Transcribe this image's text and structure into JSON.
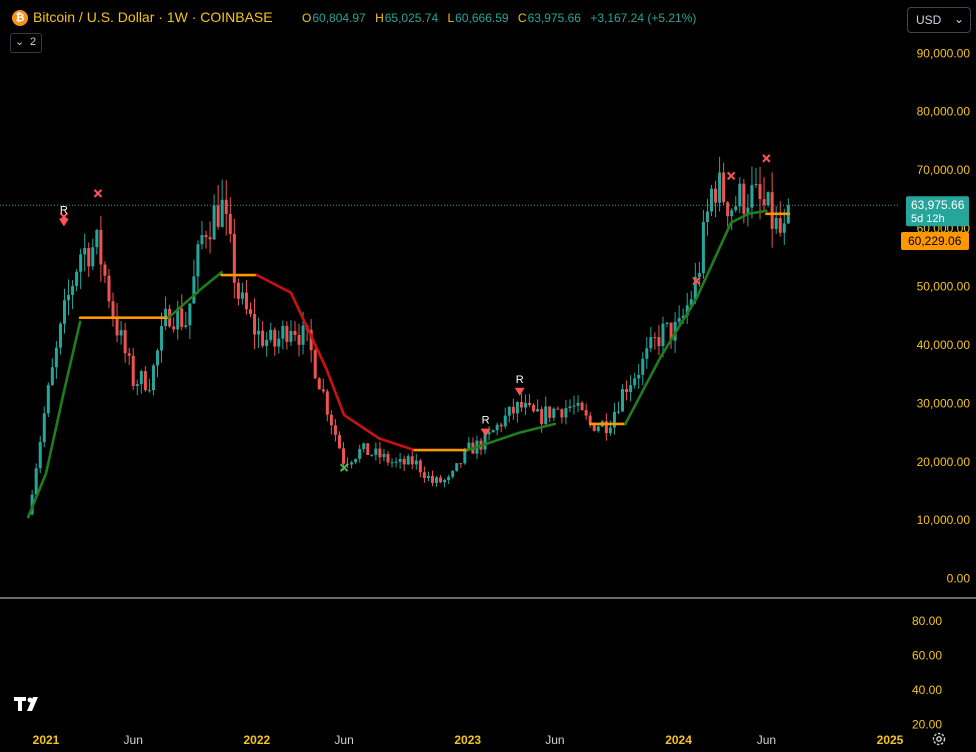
{
  "header": {
    "symbol_icon": "bitcoin-icon",
    "title": "Bitcoin / U.S. Dollar · 1W · COINBASE",
    "ohlc": [
      {
        "key": "O",
        "value": "60,804.97"
      },
      {
        "key": "H",
        "value": "65,025.74"
      },
      {
        "key": "L",
        "value": "60,666.59"
      },
      {
        "key": "C",
        "value": "63,975.66"
      }
    ],
    "change": "+3,167.24 (+5.21%)",
    "collapse_count": "2",
    "currency": "USD"
  },
  "colors": {
    "up": "#26a69a",
    "down": "#ef5350",
    "trail_up": "#1e7d1e",
    "trail_down": "#cc1111",
    "flat": "#ff9800",
    "title": "#f5c518",
    "signal": "#ff5252",
    "green_x": "#4caf50"
  },
  "chart_data": [
    {
      "type": "candlestick",
      "title": "Bitcoin / U.S. Dollar · 1W · COINBASE",
      "y_ticks": [
        "90,000.00",
        "80,000.00",
        "70,000.00",
        "60,000.00",
        "50,000.00",
        "40,000.00",
        "30,000.00",
        "20,000.00",
        "10,000.00",
        "0.00"
      ],
      "ylim": [
        -3000,
        94000
      ],
      "x_ticks": [
        {
          "label": "2021",
          "date": "2021-01"
        },
        {
          "label": "Jun",
          "date": "2021-06"
        },
        {
          "label": "2022",
          "date": "2022-01"
        },
        {
          "label": "Jun",
          "date": "2022-06"
        },
        {
          "label": "2023",
          "date": "2023-01"
        },
        {
          "label": "Jun",
          "date": "2023-06"
        },
        {
          "label": "2024",
          "date": "2024-01"
        },
        {
          "label": "Jun",
          "date": "2024-06"
        },
        {
          "label": "2025",
          "date": "2025-01"
        }
      ],
      "last_price": {
        "label": "63,975.66",
        "value": 63975.66,
        "countdown": "5d 12h"
      },
      "trail_label": {
        "label": "60,229.06",
        "value": 60229.06
      },
      "close_path": [
        [
          "2020-12",
          11000
        ],
        [
          "2021-01",
          30000
        ],
        [
          "2021-02",
          45000
        ],
        [
          "2021-03",
          56000
        ],
        [
          "2021-04",
          57000
        ],
        [
          "2021-05",
          44000
        ],
        [
          "2021-06",
          34000
        ],
        [
          "2021-07",
          34000
        ],
        [
          "2021-08",
          46000
        ],
        [
          "2021-09",
          44000
        ],
        [
          "2021-10",
          60000
        ],
        [
          "2021-11",
          64000
        ],
        [
          "2021-12",
          48000
        ],
        [
          "2022-01",
          42000
        ],
        [
          "2022-02",
          40000
        ],
        [
          "2022-03",
          44000
        ],
        [
          "2022-04",
          40000
        ],
        [
          "2022-05",
          30000
        ],
        [
          "2022-06",
          20000
        ],
        [
          "2022-07",
          22000
        ],
        [
          "2022-08",
          21000
        ],
        [
          "2022-09",
          19500
        ],
        [
          "2022-10",
          20000
        ],
        [
          "2022-11",
          16500
        ],
        [
          "2022-12",
          16800
        ],
        [
          "2023-01",
          22000
        ],
        [
          "2023-02",
          23500
        ],
        [
          "2023-03",
          27000
        ],
        [
          "2023-04",
          29500
        ],
        [
          "2023-05",
          27500
        ],
        [
          "2023-06",
          29000
        ],
        [
          "2023-07",
          29500
        ],
        [
          "2023-08",
          26500
        ],
        [
          "2023-09",
          26500
        ],
        [
          "2023-10",
          33000
        ],
        [
          "2023-11",
          37000
        ],
        [
          "2023-12",
          42000
        ],
        [
          "2024-01",
          42500
        ],
        [
          "2024-02",
          51000
        ],
        [
          "2024-03",
          68000
        ],
        [
          "2024-04",
          64000
        ],
        [
          "2024-05",
          66000
        ],
        [
          "2024-06",
          63000
        ],
        [
          "2024-07",
          58000
        ],
        [
          "2024-07-10",
          63975.66
        ]
      ],
      "trail_path": [
        {
          "dir": "up",
          "points": [
            [
              "2020-12",
              10500
            ],
            [
              "2021-01",
              18000
            ],
            [
              "2021-02",
              32000
            ],
            [
              "2021-03",
              44000
            ]
          ]
        },
        {
          "dir": "flat",
          "points": [
            [
              "2021-03",
              44700
            ],
            [
              "2021-08",
              44700
            ]
          ]
        },
        {
          "dir": "up",
          "points": [
            [
              "2021-08",
              44700
            ],
            [
              "2021-10",
              50000
            ],
            [
              "2021-11",
              52500
            ]
          ]
        },
        {
          "dir": "flat",
          "points": [
            [
              "2021-11",
              52000
            ],
            [
              "2022-01",
              52000
            ]
          ]
        },
        {
          "dir": "down",
          "points": [
            [
              "2022-01",
              52000
            ],
            [
              "2022-03",
              49000
            ],
            [
              "2022-05",
              36000
            ],
            [
              "2022-06",
              28000
            ],
            [
              "2022-08",
              24000
            ],
            [
              "2022-10",
              22000
            ]
          ]
        },
        {
          "dir": "flat",
          "points": [
            [
              "2022-10",
              22000
            ],
            [
              "2023-01",
              22000
            ]
          ]
        },
        {
          "dir": "up",
          "points": [
            [
              "2023-01",
              22000
            ],
            [
              "2023-04",
              25000
            ],
            [
              "2023-06",
              26500
            ]
          ]
        },
        {
          "dir": "flat",
          "points": [
            [
              "2023-08",
              26500
            ],
            [
              "2023-10",
              26500
            ]
          ]
        },
        {
          "dir": "up",
          "points": [
            [
              "2023-10",
              26500
            ],
            [
              "2023-12",
              38000
            ],
            [
              "2024-02",
              48000
            ],
            [
              "2024-04",
              61000
            ],
            [
              "2024-05",
              62500
            ],
            [
              "2024-06",
              63000
            ]
          ]
        },
        {
          "dir": "flat",
          "points": [
            [
              "2024-06",
              62500
            ],
            [
              "2024-07-10",
              62500
            ]
          ]
        }
      ],
      "markers": [
        {
          "kind": "x",
          "date": "2021-02",
          "value": 62000
        },
        {
          "kind": "R",
          "date": "2021-02",
          "value": 61000
        },
        {
          "kind": "x",
          "date": "2021-04",
          "value": 66000
        },
        {
          "kind": "x",
          "date": "2022-06",
          "value": 19000,
          "color": "green"
        },
        {
          "kind": "R",
          "date": "2023-02",
          "value": 25000
        },
        {
          "kind": "R",
          "date": "2023-04",
          "value": 32000
        },
        {
          "kind": "x",
          "date": "2024-02",
          "value": 51000
        },
        {
          "kind": "x",
          "date": "2024-04",
          "value": 69000
        },
        {
          "kind": "x",
          "date": "2024-06",
          "value": 72000
        }
      ]
    },
    {
      "type": "line",
      "title": "",
      "y_ticks": [
        "80.00",
        "60.00",
        "40.00",
        "20.00"
      ],
      "ylim": [
        18,
        92
      ],
      "series": []
    }
  ]
}
